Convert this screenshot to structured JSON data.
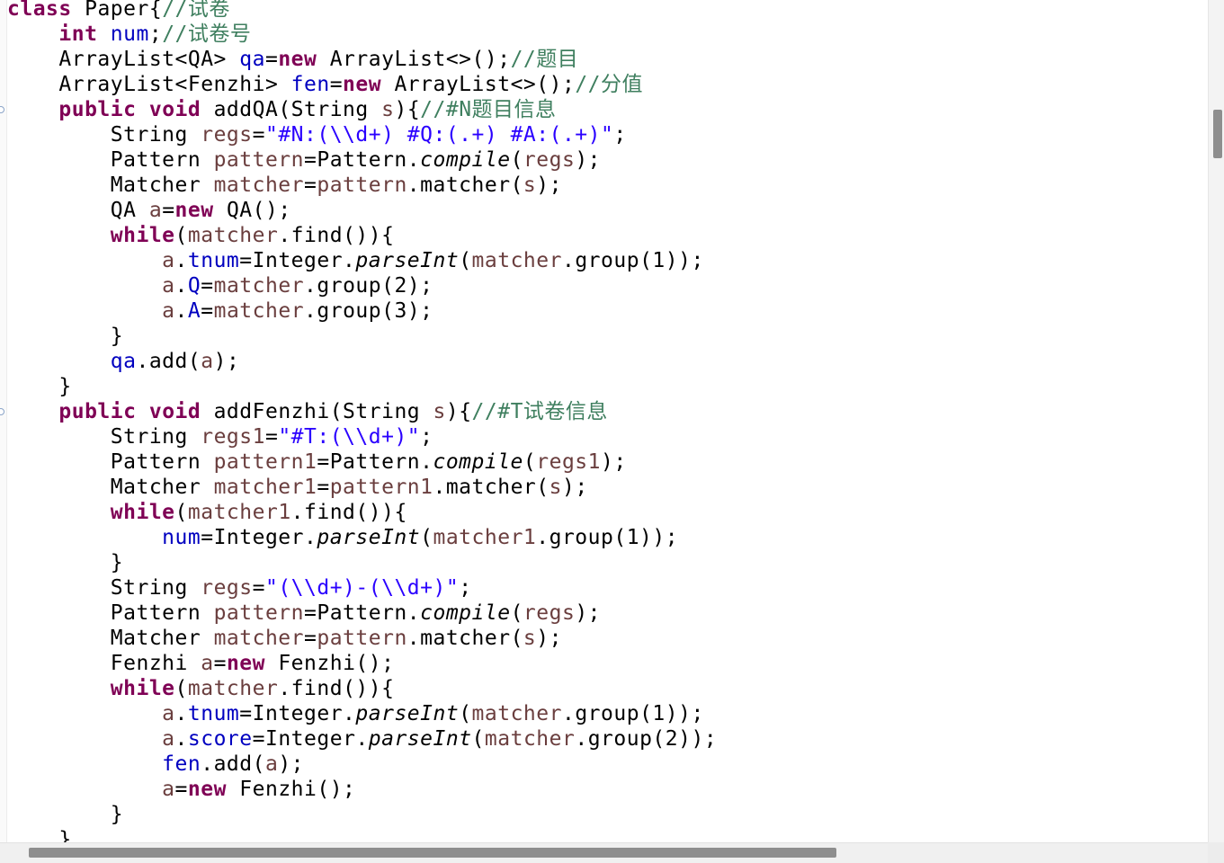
{
  "editor": {
    "language": "java",
    "colors": {
      "keyword": "#7f0055",
      "field": "#0000c0",
      "local_variable": "#6a3e3e",
      "string": "#2a00ff",
      "comment": "#3f7f5f",
      "plain": "#000000"
    },
    "fold_markers": [
      "collapse-icon",
      "collapse-icon"
    ],
    "lines": [
      [
        [
          "kw",
          "class"
        ],
        [
          "p",
          " Paper{"
        ],
        [
          "cmt",
          "//试卷"
        ]
      ],
      [
        [
          "p",
          "    "
        ],
        [
          "kw",
          "int"
        ],
        [
          "p",
          " "
        ],
        [
          "fld",
          "num"
        ],
        [
          "p",
          ";"
        ],
        [
          "cmt",
          "//试卷号"
        ]
      ],
      [
        [
          "p",
          "    ArrayList<QA> "
        ],
        [
          "fld",
          "qa"
        ],
        [
          "p",
          "="
        ],
        [
          "kw",
          "new"
        ],
        [
          "p",
          " ArrayList<>();"
        ],
        [
          "cmt",
          "//题目"
        ]
      ],
      [
        [
          "p",
          "    ArrayList<Fenzhi> "
        ],
        [
          "fld",
          "fen"
        ],
        [
          "p",
          "="
        ],
        [
          "kw",
          "new"
        ],
        [
          "p",
          " ArrayList<>();"
        ],
        [
          "cmt",
          "//分值"
        ]
      ],
      [
        [
          "p",
          "    "
        ],
        [
          "kw",
          "public"
        ],
        [
          "p",
          " "
        ],
        [
          "kw",
          "void"
        ],
        [
          "p",
          " addQA(String "
        ],
        [
          "var",
          "s"
        ],
        [
          "p",
          "){"
        ],
        [
          "cmt",
          "//#N题目信息"
        ]
      ],
      [
        [
          "p",
          "        String "
        ],
        [
          "var",
          "regs"
        ],
        [
          "p",
          "="
        ],
        [
          "str",
          "\"#N:(\\\\d+) #Q:(.+) #A:(.+)\""
        ],
        [
          "p",
          ";"
        ]
      ],
      [
        [
          "p",
          "        Pattern "
        ],
        [
          "var",
          "pattern"
        ],
        [
          "p",
          "=Pattern."
        ],
        [
          "st",
          "compile"
        ],
        [
          "p",
          "("
        ],
        [
          "var",
          "regs"
        ],
        [
          "p",
          ");"
        ]
      ],
      [
        [
          "p",
          "        Matcher "
        ],
        [
          "var",
          "matcher"
        ],
        [
          "p",
          "="
        ],
        [
          "var",
          "pattern"
        ],
        [
          "p",
          ".matcher("
        ],
        [
          "var",
          "s"
        ],
        [
          "p",
          ");"
        ]
      ],
      [
        [
          "p",
          "        QA "
        ],
        [
          "var",
          "a"
        ],
        [
          "p",
          "="
        ],
        [
          "kw",
          "new"
        ],
        [
          "p",
          " QA();"
        ]
      ],
      [
        [
          "p",
          "        "
        ],
        [
          "kw",
          "while"
        ],
        [
          "p",
          "("
        ],
        [
          "var",
          "matcher"
        ],
        [
          "p",
          ".find()){"
        ]
      ],
      [
        [
          "p",
          "            "
        ],
        [
          "var",
          "a"
        ],
        [
          "p",
          "."
        ],
        [
          "fld",
          "tnum"
        ],
        [
          "p",
          "=Integer."
        ],
        [
          "st",
          "parseInt"
        ],
        [
          "p",
          "("
        ],
        [
          "var",
          "matcher"
        ],
        [
          "p",
          ".group(1));"
        ]
      ],
      [
        [
          "p",
          "            "
        ],
        [
          "var",
          "a"
        ],
        [
          "p",
          "."
        ],
        [
          "fld",
          "Q"
        ],
        [
          "p",
          "="
        ],
        [
          "var",
          "matcher"
        ],
        [
          "p",
          ".group(2);"
        ]
      ],
      [
        [
          "p",
          "            "
        ],
        [
          "var",
          "a"
        ],
        [
          "p",
          "."
        ],
        [
          "fld",
          "A"
        ],
        [
          "p",
          "="
        ],
        [
          "var",
          "matcher"
        ],
        [
          "p",
          ".group(3);"
        ]
      ],
      [
        [
          "p",
          "        }"
        ]
      ],
      [
        [
          "p",
          "        "
        ],
        [
          "fld",
          "qa"
        ],
        [
          "p",
          ".add("
        ],
        [
          "var",
          "a"
        ],
        [
          "p",
          ");"
        ]
      ],
      [
        [
          "p",
          "    }"
        ]
      ],
      [
        [
          "p",
          "    "
        ],
        [
          "kw",
          "public"
        ],
        [
          "p",
          " "
        ],
        [
          "kw",
          "void"
        ],
        [
          "p",
          " addFenzhi(String "
        ],
        [
          "var",
          "s"
        ],
        [
          "p",
          "){"
        ],
        [
          "cmt",
          "//#T试卷信息"
        ]
      ],
      [
        [
          "p",
          "        String "
        ],
        [
          "var",
          "regs1"
        ],
        [
          "p",
          "="
        ],
        [
          "str",
          "\"#T:(\\\\d+)\""
        ],
        [
          "p",
          ";"
        ]
      ],
      [
        [
          "p",
          "        Pattern "
        ],
        [
          "var",
          "pattern1"
        ],
        [
          "p",
          "=Pattern."
        ],
        [
          "st",
          "compile"
        ],
        [
          "p",
          "("
        ],
        [
          "var",
          "regs1"
        ],
        [
          "p",
          ");"
        ]
      ],
      [
        [
          "p",
          "        Matcher "
        ],
        [
          "var",
          "matcher1"
        ],
        [
          "p",
          "="
        ],
        [
          "var",
          "pattern1"
        ],
        [
          "p",
          ".matcher("
        ],
        [
          "var",
          "s"
        ],
        [
          "p",
          ");"
        ]
      ],
      [
        [
          "p",
          "        "
        ],
        [
          "kw",
          "while"
        ],
        [
          "p",
          "("
        ],
        [
          "var",
          "matcher1"
        ],
        [
          "p",
          ".find()){"
        ]
      ],
      [
        [
          "p",
          "            "
        ],
        [
          "fld",
          "num"
        ],
        [
          "p",
          "=Integer."
        ],
        [
          "st",
          "parseInt"
        ],
        [
          "p",
          "("
        ],
        [
          "var",
          "matcher1"
        ],
        [
          "p",
          ".group(1));"
        ]
      ],
      [
        [
          "p",
          "        }"
        ]
      ],
      [
        [
          "p",
          "        String "
        ],
        [
          "var",
          "regs"
        ],
        [
          "p",
          "="
        ],
        [
          "str",
          "\"(\\\\d+)-(\\\\d+)\""
        ],
        [
          "p",
          ";"
        ]
      ],
      [
        [
          "p",
          "        Pattern "
        ],
        [
          "var",
          "pattern"
        ],
        [
          "p",
          "=Pattern."
        ],
        [
          "st",
          "compile"
        ],
        [
          "p",
          "("
        ],
        [
          "var",
          "regs"
        ],
        [
          "p",
          ");"
        ]
      ],
      [
        [
          "p",
          "        Matcher "
        ],
        [
          "var",
          "matcher"
        ],
        [
          "p",
          "="
        ],
        [
          "var",
          "pattern"
        ],
        [
          "p",
          ".matcher("
        ],
        [
          "var",
          "s"
        ],
        [
          "p",
          ");"
        ]
      ],
      [
        [
          "p",
          "        Fenzhi "
        ],
        [
          "var",
          "a"
        ],
        [
          "p",
          "="
        ],
        [
          "kw",
          "new"
        ],
        [
          "p",
          " Fenzhi();"
        ]
      ],
      [
        [
          "p",
          "        "
        ],
        [
          "kw",
          "while"
        ],
        [
          "p",
          "("
        ],
        [
          "var",
          "matcher"
        ],
        [
          "p",
          ".find()){"
        ]
      ],
      [
        [
          "p",
          "            "
        ],
        [
          "var",
          "a"
        ],
        [
          "p",
          "."
        ],
        [
          "fld",
          "tnum"
        ],
        [
          "p",
          "=Integer."
        ],
        [
          "st",
          "parseInt"
        ],
        [
          "p",
          "("
        ],
        [
          "var",
          "matcher"
        ],
        [
          "p",
          ".group(1));"
        ]
      ],
      [
        [
          "p",
          "            "
        ],
        [
          "var",
          "a"
        ],
        [
          "p",
          "."
        ],
        [
          "fld",
          "score"
        ],
        [
          "p",
          "=Integer."
        ],
        [
          "st",
          "parseInt"
        ],
        [
          "p",
          "("
        ],
        [
          "var",
          "matcher"
        ],
        [
          "p",
          ".group(2));"
        ]
      ],
      [
        [
          "p",
          "            "
        ],
        [
          "fld",
          "fen"
        ],
        [
          "p",
          ".add("
        ],
        [
          "var",
          "a"
        ],
        [
          "p",
          ");"
        ]
      ],
      [
        [
          "p",
          "            "
        ],
        [
          "var",
          "a"
        ],
        [
          "p",
          "="
        ],
        [
          "kw",
          "new"
        ],
        [
          "p",
          " Fenzhi();"
        ]
      ],
      [
        [
          "p",
          "        }"
        ]
      ],
      [
        [
          "p",
          "    }"
        ]
      ]
    ]
  }
}
